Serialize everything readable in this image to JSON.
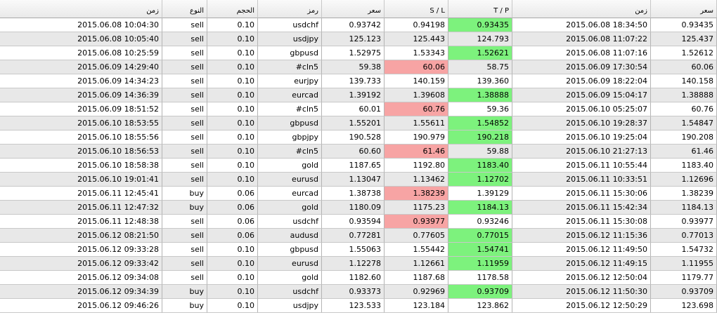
{
  "colors": {
    "tp_hit": "#7df27d",
    "sl_hit": "#f7a4a4",
    "alt_row": "#e8e8e8"
  },
  "header": [
    "زمن",
    "النوع",
    "الحجم",
    "رمز",
    "سعر",
    "S / L",
    "T / P",
    "زمن",
    "سعر"
  ],
  "trades": [
    {
      "open_time": "2015.06.08 10:04:30",
      "type": "sell",
      "volume": "0.10",
      "symbol": "usdchf",
      "open_price": "0.93742",
      "sl": "0.94198",
      "tp": "0.93435",
      "close_time": "2015.06.08 18:34:50",
      "close_price": "0.93435",
      "hit": "tp"
    },
    {
      "open_time": "2015.06.08 10:05:40",
      "type": "sell",
      "volume": "0.10",
      "symbol": "usdjpy",
      "open_price": "125.123",
      "sl": "125.443",
      "tp": "124.793",
      "close_time": "2015.06.08 11:07:22",
      "close_price": "125.437",
      "hit": ""
    },
    {
      "open_time": "2015.06.08 10:25:59",
      "type": "sell",
      "volume": "0.10",
      "symbol": "gbpusd",
      "open_price": "1.52975",
      "sl": "1.53343",
      "tp": "1.52621",
      "close_time": "2015.06.08 11:07:16",
      "close_price": "1.52612",
      "hit": "tp"
    },
    {
      "open_time": "2015.06.09 14:29:40",
      "type": "sell",
      "volume": "0.10",
      "symbol": "#cln5",
      "open_price": "59.38",
      "sl": "60.06",
      "tp": "58.75",
      "close_time": "2015.06.09 17:30:54",
      "close_price": "60.06",
      "hit": "sl"
    },
    {
      "open_time": "2015.06.09 14:34:23",
      "type": "sell",
      "volume": "0.10",
      "symbol": "eurjpy",
      "open_price": "139.733",
      "sl": "140.159",
      "tp": "139.360",
      "close_time": "2015.06.09 18:22:04",
      "close_price": "140.158",
      "hit": ""
    },
    {
      "open_time": "2015.06.09 14:36:39",
      "type": "sell",
      "volume": "0.10",
      "symbol": "eurcad",
      "open_price": "1.39192",
      "sl": "1.39608",
      "tp": "1.38888",
      "close_time": "2015.06.09 15:04:17",
      "close_price": "1.38888",
      "hit": "tp"
    },
    {
      "open_time": "2015.06.09 18:51:52",
      "type": "sell",
      "volume": "0.10",
      "symbol": "#cln5",
      "open_price": "60.01",
      "sl": "60.76",
      "tp": "59.36",
      "close_time": "2015.06.10 05:25:07",
      "close_price": "60.76",
      "hit": "sl"
    },
    {
      "open_time": "2015.06.10 18:53:55",
      "type": "sell",
      "volume": "0.10",
      "symbol": "gbpusd",
      "open_price": "1.55201",
      "sl": "1.55611",
      "tp": "1.54852",
      "close_time": "2015.06.10 19:28:37",
      "close_price": "1.54847",
      "hit": "tp"
    },
    {
      "open_time": "2015.06.10 18:55:56",
      "type": "sell",
      "volume": "0.10",
      "symbol": "gbpjpy",
      "open_price": "190.528",
      "sl": "190.979",
      "tp": "190.218",
      "close_time": "2015.06.10 19:25:04",
      "close_price": "190.208",
      "hit": "tp"
    },
    {
      "open_time": "2015.06.10 18:56:53",
      "type": "sell",
      "volume": "0.10",
      "symbol": "#cln5",
      "open_price": "60.60",
      "sl": "61.46",
      "tp": "59.88",
      "close_time": "2015.06.10 21:27:13",
      "close_price": "61.46",
      "hit": "sl"
    },
    {
      "open_time": "2015.06.10 18:58:38",
      "type": "sell",
      "volume": "0.10",
      "symbol": "gold",
      "open_price": "1187.65",
      "sl": "1192.80",
      "tp": "1183.40",
      "close_time": "2015.06.11 10:55:44",
      "close_price": "1183.40",
      "hit": "tp"
    },
    {
      "open_time": "2015.06.10 19:01:41",
      "type": "sell",
      "volume": "0.10",
      "symbol": "eurusd",
      "open_price": "1.13047",
      "sl": "1.13462",
      "tp": "1.12702",
      "close_time": "2015.06.11 10:33:51",
      "close_price": "1.12696",
      "hit": "tp"
    },
    {
      "open_time": "2015.06.11 12:45:41",
      "type": "buy",
      "volume": "0.06",
      "symbol": "eurcad",
      "open_price": "1.38738",
      "sl": "1.38239",
      "tp": "1.39129",
      "close_time": "2015.06.11 15:30:06",
      "close_price": "1.38239",
      "hit": "sl"
    },
    {
      "open_time": "2015.06.11 12:47:32",
      "type": "buy",
      "volume": "0.06",
      "symbol": "gold",
      "open_price": "1180.09",
      "sl": "1175.23",
      "tp": "1184.13",
      "close_time": "2015.06.11 15:42:34",
      "close_price": "1184.13",
      "hit": "tp"
    },
    {
      "open_time": "2015.06.11 12:48:38",
      "type": "sell",
      "volume": "0.06",
      "symbol": "usdchf",
      "open_price": "0.93594",
      "sl": "0.93977",
      "tp": "0.93246",
      "close_time": "2015.06.11 15:30:08",
      "close_price": "0.93977",
      "hit": "sl"
    },
    {
      "open_time": "2015.06.12 08:21:50",
      "type": "sell",
      "volume": "0.06",
      "symbol": "audusd",
      "open_price": "0.77281",
      "sl": "0.77605",
      "tp": "0.77015",
      "close_time": "2015.06.12 11:15:36",
      "close_price": "0.77013",
      "hit": "tp"
    },
    {
      "open_time": "2015.06.12 09:33:28",
      "type": "sell",
      "volume": "0.10",
      "symbol": "gbpusd",
      "open_price": "1.55063",
      "sl": "1.55442",
      "tp": "1.54741",
      "close_time": "2015.06.12 11:49:50",
      "close_price": "1.54732",
      "hit": "tp"
    },
    {
      "open_time": "2015.06.12 09:33:42",
      "type": "sell",
      "volume": "0.10",
      "symbol": "eurusd",
      "open_price": "1.12278",
      "sl": "1.12661",
      "tp": "1.11959",
      "close_time": "2015.06.12 11:49:15",
      "close_price": "1.11955",
      "hit": "tp"
    },
    {
      "open_time": "2015.06.12 09:34:08",
      "type": "sell",
      "volume": "0.10",
      "symbol": "gold",
      "open_price": "1182.60",
      "sl": "1187.68",
      "tp": "1178.58",
      "close_time": "2015.06.12 12:50:04",
      "close_price": "1179.77",
      "hit": ""
    },
    {
      "open_time": "2015.06.12 09:34:39",
      "type": "buy",
      "volume": "0.10",
      "symbol": "usdchf",
      "open_price": "0.93373",
      "sl": "0.92969",
      "tp": "0.93709",
      "close_time": "2015.06.12 11:50:30",
      "close_price": "0.93709",
      "hit": "tp"
    },
    {
      "open_time": "2015.06.12 09:46:26",
      "type": "buy",
      "volume": "0.10",
      "symbol": "usdjpy",
      "open_price": "123.533",
      "sl": "123.184",
      "tp": "123.862",
      "close_time": "2015.06.12 12:50:29",
      "close_price": "123.698",
      "hit": ""
    }
  ]
}
